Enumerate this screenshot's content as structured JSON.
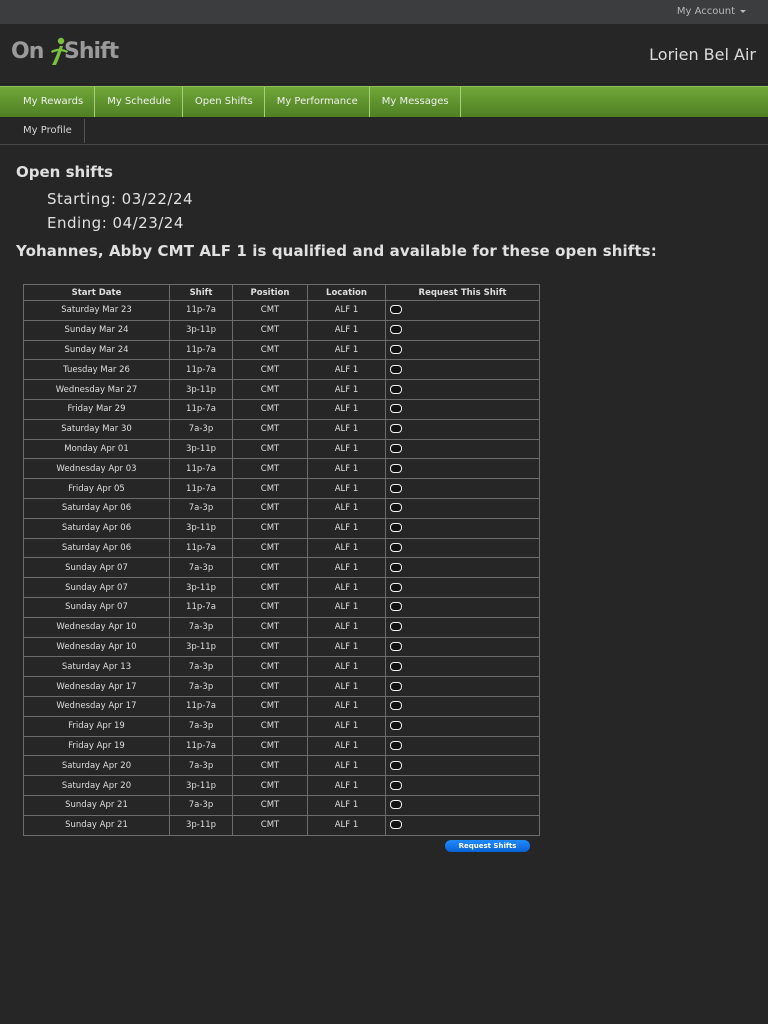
{
  "topbar": {
    "account_label": "My Account"
  },
  "header": {
    "logo_text_left": "On",
    "logo_text_right": "Shift",
    "facility_name": "Lorien Bel Air"
  },
  "nav": [
    {
      "label": "My Rewards"
    },
    {
      "label": "My Schedule"
    },
    {
      "label": "Open Shifts"
    },
    {
      "label": "My Performance"
    },
    {
      "label": "My Messages"
    }
  ],
  "subnav": {
    "profile_label": "My Profile"
  },
  "main": {
    "title": "Open shifts",
    "starting": "Starting: 03/22/24",
    "ending": "Ending: 04/23/24",
    "qualified_text": "Yohannes, Abby CMT ALF 1 is qualified and available for these open shifts:"
  },
  "table": {
    "headers": [
      "Start Date",
      "Shift",
      "Position",
      "Location",
      "Request This Shift"
    ],
    "rows": [
      [
        "Saturday Mar 23",
        "11p-7a",
        "CMT",
        "ALF 1"
      ],
      [
        "Sunday Mar 24",
        "3p-11p",
        "CMT",
        "ALF 1"
      ],
      [
        "Sunday Mar 24",
        "11p-7a",
        "CMT",
        "ALF 1"
      ],
      [
        "Tuesday Mar 26",
        "11p-7a",
        "CMT",
        "ALF 1"
      ],
      [
        "Wednesday Mar 27",
        "3p-11p",
        "CMT",
        "ALF 1"
      ],
      [
        "Friday Mar 29",
        "11p-7a",
        "CMT",
        "ALF 1"
      ],
      [
        "Saturday Mar 30",
        "7a-3p",
        "CMT",
        "ALF 1"
      ],
      [
        "Monday Apr 01",
        "3p-11p",
        "CMT",
        "ALF 1"
      ],
      [
        "Wednesday Apr 03",
        "11p-7a",
        "CMT",
        "ALF 1"
      ],
      [
        "Friday Apr 05",
        "11p-7a",
        "CMT",
        "ALF 1"
      ],
      [
        "Saturday Apr 06",
        "7a-3p",
        "CMT",
        "ALF 1"
      ],
      [
        "Saturday Apr 06",
        "3p-11p",
        "CMT",
        "ALF 1"
      ],
      [
        "Saturday Apr 06",
        "11p-7a",
        "CMT",
        "ALF 1"
      ],
      [
        "Sunday Apr 07",
        "7a-3p",
        "CMT",
        "ALF 1"
      ],
      [
        "Sunday Apr 07",
        "3p-11p",
        "CMT",
        "ALF 1"
      ],
      [
        "Sunday Apr 07",
        "11p-7a",
        "CMT",
        "ALF 1"
      ],
      [
        "Wednesday Apr 10",
        "7a-3p",
        "CMT",
        "ALF 1"
      ],
      [
        "Wednesday Apr 10",
        "3p-11p",
        "CMT",
        "ALF 1"
      ],
      [
        "Saturday Apr 13",
        "7a-3p",
        "CMT",
        "ALF 1"
      ],
      [
        "Wednesday Apr 17",
        "7a-3p",
        "CMT",
        "ALF 1"
      ],
      [
        "Wednesday Apr 17",
        "11p-7a",
        "CMT",
        "ALF 1"
      ],
      [
        "Friday Apr 19",
        "7a-3p",
        "CMT",
        "ALF 1"
      ],
      [
        "Friday Apr 19",
        "11p-7a",
        "CMT",
        "ALF 1"
      ],
      [
        "Saturday Apr 20",
        "7a-3p",
        "CMT",
        "ALF 1"
      ],
      [
        "Saturday Apr 20",
        "3p-11p",
        "CMT",
        "ALF 1"
      ],
      [
        "Sunday Apr 21",
        "7a-3p",
        "CMT",
        "ALF 1"
      ],
      [
        "Sunday Apr 21",
        "3p-11p",
        "CMT",
        "ALF 1"
      ]
    ]
  },
  "actions": {
    "request_button_label": "Request Shifts"
  },
  "colors": {
    "nav_green": "#5e9230",
    "button_blue": "#1577ea",
    "background": "#262626"
  }
}
